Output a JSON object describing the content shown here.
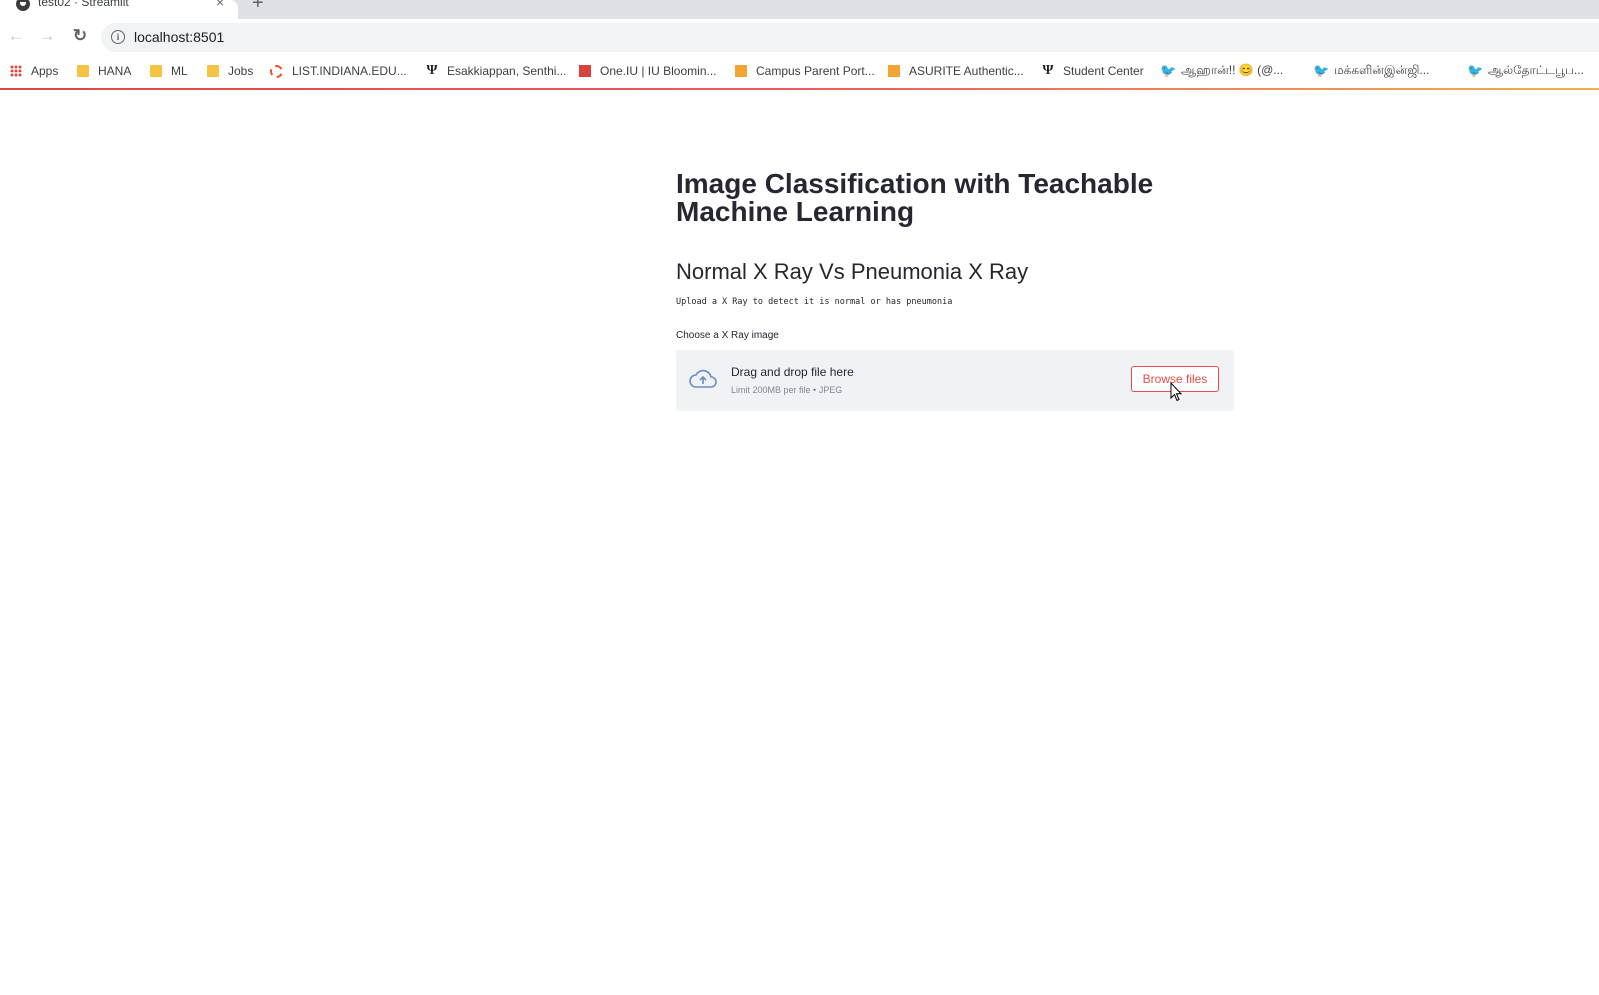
{
  "browser": {
    "tab_title": "test02 · Streamlit",
    "tab_close": "×",
    "new_tab": "+",
    "url": "localhost:8501",
    "nav": {
      "back": "←",
      "forward": "→",
      "reload": "↻"
    },
    "info_icon_glyph": "i"
  },
  "bookmarks": [
    {
      "label": "Apps",
      "icon": "apps-grid-icon"
    },
    {
      "label": "HANA",
      "icon": "folder-icon"
    },
    {
      "label": "ML",
      "icon": "folder-icon"
    },
    {
      "label": "Jobs",
      "icon": "folder-icon"
    },
    {
      "label": "LIST.INDIANA.EDU...",
      "icon": "spinner-logo-icon"
    },
    {
      "label": "Esakkiappan, Senthi...",
      "icon": "iu-trident-icon"
    },
    {
      "label": "One.IU | IU Bloomin...",
      "icon": "red-square-icon"
    },
    {
      "label": "Campus Parent Port...",
      "icon": "orange-box-icon"
    },
    {
      "label": "ASURITE Authentic...",
      "icon": "orange-box-icon"
    },
    {
      "label": "Student Center",
      "icon": "iu-trident-icon"
    },
    {
      "label": "ஆஹான்!! 😊 (@...",
      "icon": "twitter-bird-icon"
    },
    {
      "label": "மக்களின்இன்ஜி...",
      "icon": "twitter-bird-icon"
    },
    {
      "label": "ஆல்தோட்டபூப...",
      "icon": "twitter-bird-icon"
    }
  ],
  "page": {
    "title": "Image Classification with Teachable Machine Learning",
    "subheader": "Normal X Ray Vs Pneumonia X Ray",
    "code_text": "Upload a X Ray to detect it is normal or has pneumonia",
    "uploader": {
      "label": "Choose a X Ray image",
      "drop_text": "Drag and drop file here",
      "limit_text": "Limit 200MB per file • ",
      "file_types": "JPEG",
      "button_label": "Browse files"
    }
  },
  "colors": {
    "accent": "#ea4a4a",
    "text": "#262730",
    "uploader_bg": "#f0f2f6"
  }
}
